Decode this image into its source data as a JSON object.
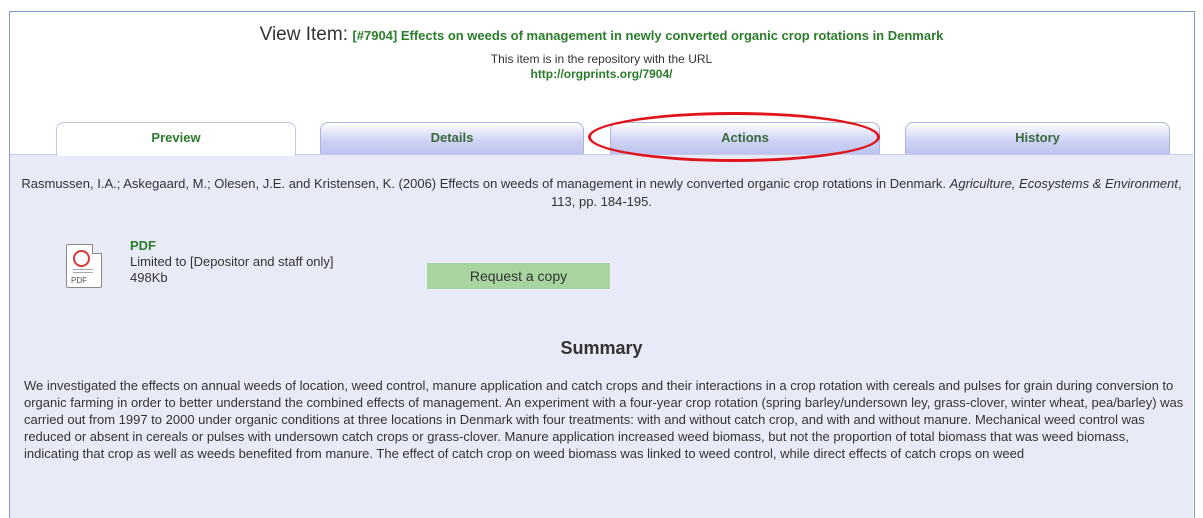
{
  "item": {
    "prefix": "View Item:",
    "title": "[#7904] Effects on weeds of management in newly converted organic crop rotations in Denmark",
    "repo_note": "This item is in the repository with the URL",
    "url": "http://orgprints.org/7904/"
  },
  "tabs": [
    {
      "label": "Preview"
    },
    {
      "label": "Details"
    },
    {
      "label": "Actions"
    },
    {
      "label": "History"
    }
  ],
  "citation": {
    "before": "Rasmussen, I.A.; Askegaard, M.; Olesen, J.E. and Kristensen, K. (2006) Effects on weeds of management in newly converted organic crop rotations in Denmark.",
    "journal": "Agriculture, Ecosystems & Environment",
    "after": ", 113, pp. 184-195."
  },
  "document": {
    "icon": "pdf-file-icon",
    "format": "PDF",
    "access": "Limited to [Depositor and staff only]",
    "size": "498Kb",
    "request_label": "Request a copy"
  },
  "summary": {
    "heading": "Summary",
    "text": "We investigated the effects on annual weeds of location, weed control, manure application and catch crops and their interactions in a crop rotation with cereals and pulses for grain during conversion to organic farming in order to better understand the combined effects of management. An experiment with a four-year crop rotation (spring barley/undersown ley, grass-clover, winter wheat, pea/barley) was carried out from 1997 to 2000 under organic conditions at three locations in Denmark with four treatments: with and without catch crop, and with and without manure. Mechanical weed control was reduced or absent in cereals or pulses with undersown catch crops or grass-clover. Manure application increased weed biomass, but not the proportion of total biomass that was weed biomass, indicating that crop as well as weeds benefited from manure. The effect of catch crop on weed biomass was linked to weed control, while direct effects of catch crops on weed"
  },
  "colors": {
    "link_green": "#2a7d2a",
    "panel_bg": "#e8eaf8",
    "highlight_red": "#e0141a",
    "button_green": "#a8d4a0"
  }
}
